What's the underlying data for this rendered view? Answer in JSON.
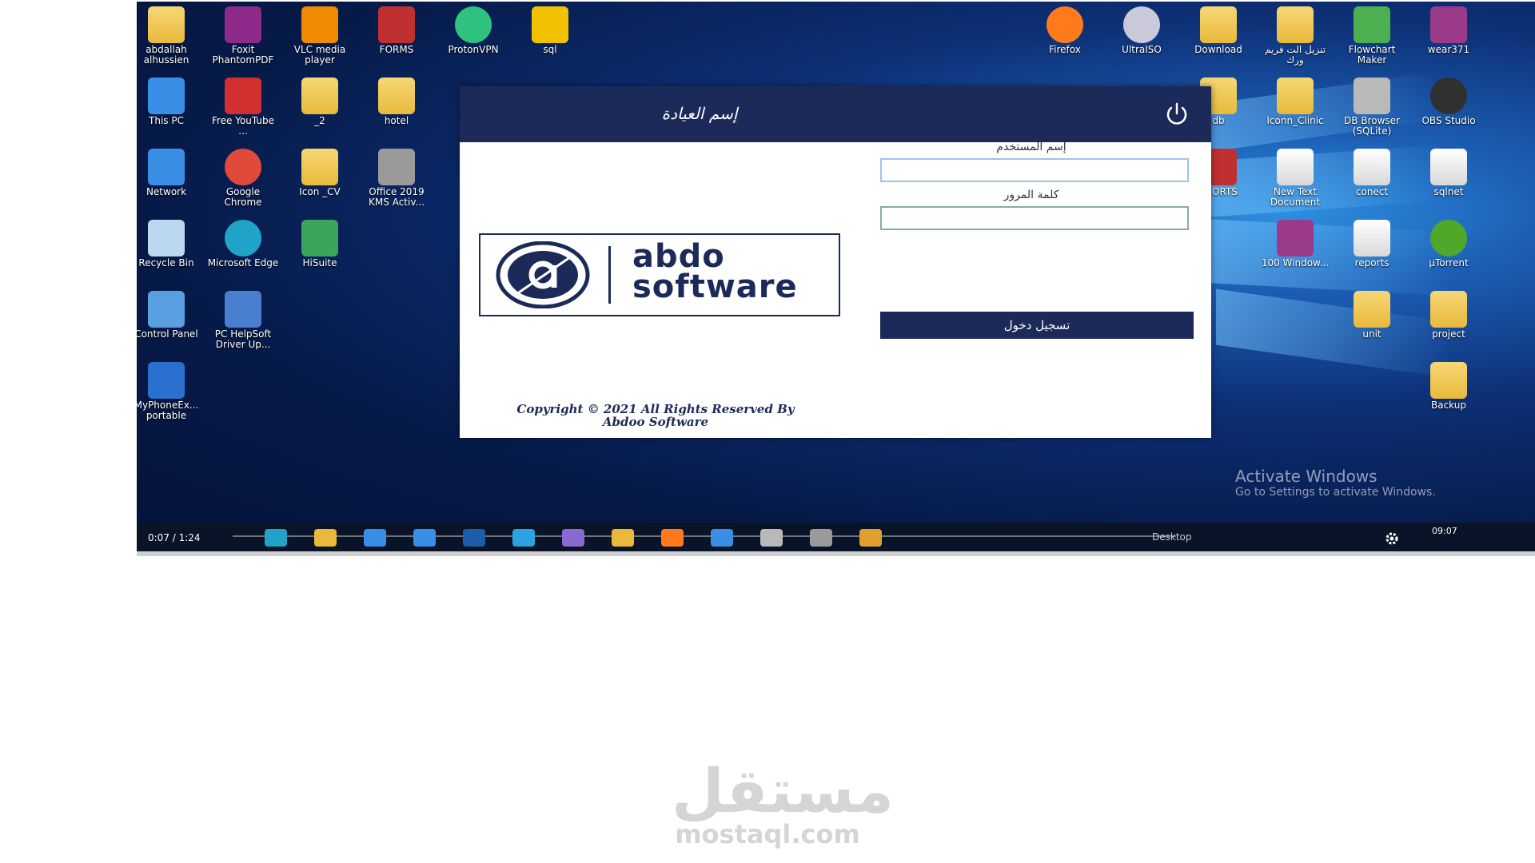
{
  "desktop": {
    "left_icons": [
      {
        "label": "abdallah alhussien",
        "kind": "user-folder-icon",
        "color": "#e9b93c"
      },
      {
        "label": "Foxit PhantomPDF",
        "kind": "pdf-icon",
        "color": "#8e2a8a"
      },
      {
        "label": "VLC media player",
        "kind": "vlc-icon",
        "color": "#f08a00"
      },
      {
        "label": "FORMS",
        "kind": "forms-icon",
        "color": "#c03030"
      },
      {
        "label": "ProtonVPN",
        "kind": "vpn-icon",
        "color": "#2ec27e"
      },
      {
        "label": "sql",
        "kind": "sql-icon",
        "color": "#f2c200"
      },
      {
        "label": "This PC",
        "kind": "computer-icon",
        "color": "#3a8ee6"
      },
      {
        "label": "Free YouTube ...",
        "kind": "download-icon",
        "color": "#d03030"
      },
      {
        "label": "_2",
        "kind": "folder-icon",
        "color": "#e9b93c"
      },
      {
        "label": "hotel",
        "kind": "folder-icon",
        "color": "#e9b93c"
      },
      {
        "label": "Network",
        "kind": "network-icon",
        "color": "#3a8ee6"
      },
      {
        "label": "Google Chrome",
        "kind": "chrome-icon",
        "color": "#e04a3a"
      },
      {
        "label": "Icon _CV",
        "kind": "folder-icon",
        "color": "#e9b93c"
      },
      {
        "label": "Office 2019 KMS Activ...",
        "kind": "key-icon",
        "color": "#9a9a9a"
      },
      {
        "label": "Recycle Bin",
        "kind": "recycle-bin-icon",
        "color": "#bcd8ee"
      },
      {
        "label": "Microsoft Edge",
        "kind": "edge-icon",
        "color": "#1fa3c9"
      },
      {
        "label": "HiSuite",
        "kind": "hisuite-icon",
        "color": "#3ba55c"
      },
      {
        "label": "Control Panel",
        "kind": "control-panel-icon",
        "color": "#5aa0e0"
      },
      {
        "label": "PC HelpSoft Driver Up...",
        "kind": "driver-icon",
        "color": "#4a7fd0"
      },
      {
        "label": "MyPhoneEx... portable",
        "kind": "phone-icon",
        "color": "#2a70d0"
      }
    ],
    "right_icons": [
      {
        "label": "Firefox",
        "kind": "firefox-icon",
        "color": "#ff7a1a"
      },
      {
        "label": "UltraISO",
        "kind": "disc-icon",
        "color": "#c9c9d9"
      },
      {
        "label": "Download",
        "kind": "folder-icon",
        "color": "#e9b93c"
      },
      {
        "label": "تنزيل الت فريم ورك",
        "kind": "folder-icon",
        "color": "#e9b93c"
      },
      {
        "label": "Flowchart Maker",
        "kind": "flowchart-icon",
        "color": "#4caf50"
      },
      {
        "label": "wear371",
        "kind": "winrar-icon",
        "color": "#9b3a8a"
      },
      {
        "label": "db",
        "kind": "folder-icon",
        "color": "#e9b93c"
      },
      {
        "label": "Iconn_Clinic",
        "kind": "folder-icon",
        "color": "#e9b93c"
      },
      {
        "label": "DB Browser (SQLite)",
        "kind": "database-icon",
        "color": "#b9b9b9"
      },
      {
        "label": "OBS Studio",
        "kind": "obs-icon",
        "color": "#303030"
      },
      {
        "label": "REORTS",
        "kind": "reports-icon",
        "color": "#c03030"
      },
      {
        "label": "New Text Document",
        "kind": "text-document-icon",
        "color": "#eeeeee"
      },
      {
        "label": "conect",
        "kind": "document-icon",
        "color": "#eeeeee"
      },
      {
        "label": "sqlnet",
        "kind": "document-icon",
        "color": "#eeeeee"
      },
      {
        "label": "100 Window...",
        "kind": "winrar-icon",
        "color": "#9b3a8a"
      },
      {
        "label": "reports",
        "kind": "document-icon",
        "color": "#eeeeee"
      },
      {
        "label": "µTorrent",
        "kind": "torrent-icon",
        "color": "#4fa82a"
      },
      {
        "label": "unit",
        "kind": "folder-icon",
        "color": "#e9b93c"
      },
      {
        "label": "project",
        "kind": "folder-icon",
        "color": "#e9b93c"
      },
      {
        "label": "Backup",
        "kind": "folder-icon",
        "color": "#e9b93c"
      }
    ],
    "activate": {
      "title": "Activate Windows",
      "subtitle": "Go to Settings to activate Windows."
    }
  },
  "login_window": {
    "title": "إسم العيادة",
    "power_icon": "power-icon",
    "logo_line1": "abdo",
    "logo_line2": "software",
    "username_label": "إسم المستخدم",
    "username_value": "",
    "password_label": "كلمة المرور",
    "password_value": "",
    "login_button": "تسجيل دخول",
    "copyright_line1": "Copyright © 2021 All Rights Reserved By",
    "copyright_line2": "Abdoo Software",
    "header_color": "#1b2a58"
  },
  "taskbar": {
    "time_code": "0:07 / 1:24",
    "desktop_label": "Desktop",
    "clock": "09:07",
    "apps": [
      {
        "kind": "edge-icon",
        "color": "#1fa3c9"
      },
      {
        "kind": "file-explorer-icon",
        "color": "#e9b93c"
      },
      {
        "kind": "store-icon",
        "color": "#3a8ee6"
      },
      {
        "kind": "mail-icon",
        "color": "#3a8ee6"
      },
      {
        "kind": "photoshop-icon",
        "color": "#1d5ca8"
      },
      {
        "kind": "telegram-icon",
        "color": "#2aa3e0"
      },
      {
        "kind": "visual-studio-icon",
        "color": "#8a6ad0"
      },
      {
        "kind": "sql-icon",
        "color": "#e9b93c"
      },
      {
        "kind": "firefox-icon",
        "color": "#ff7a1a"
      },
      {
        "kind": "windows-icon",
        "color": "#3a8ee6"
      },
      {
        "kind": "database-icon",
        "color": "#b9b9b9"
      },
      {
        "kind": "tool-icon",
        "color": "#9a9a9a"
      },
      {
        "kind": "app-icon",
        "color": "#e0a030"
      }
    ]
  },
  "watermark": {
    "arabic": "مستقل",
    "latin": "mostaql.com"
  }
}
